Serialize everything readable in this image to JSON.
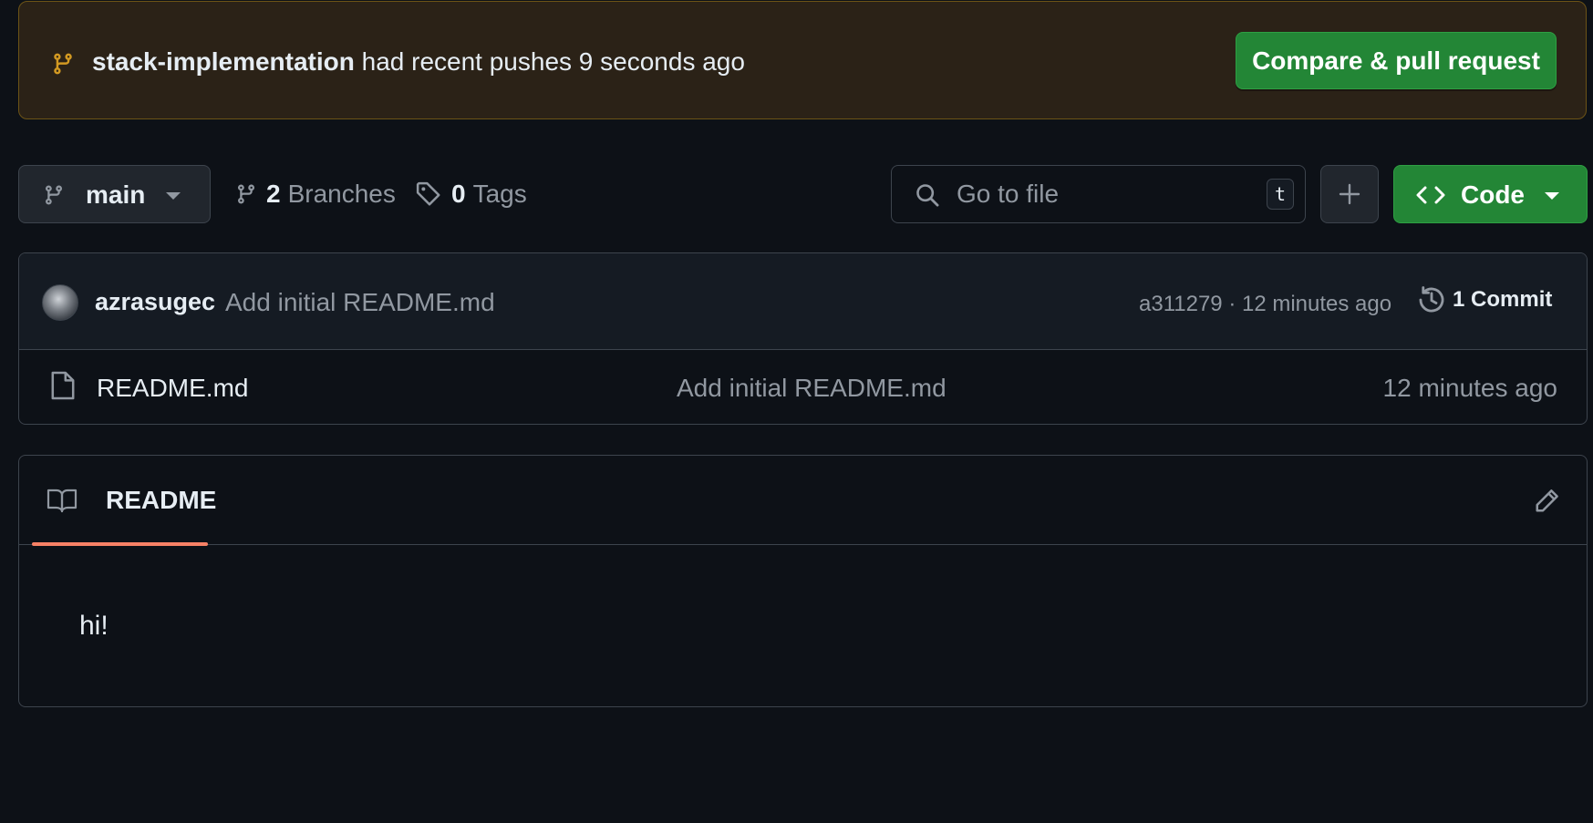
{
  "banner": {
    "branch_name": "stack-implementation",
    "message": " had recent pushes 9 seconds ago",
    "button_label": "Compare & pull request"
  },
  "toolbar": {
    "branch_selector": "main",
    "branches_count": "2",
    "branches_label": "Branches",
    "tags_count": "0",
    "tags_label": "Tags",
    "search_placeholder": "Go to file",
    "search_shortcut": "t",
    "code_label": "Code"
  },
  "latest_commit": {
    "author": "azrasugec",
    "message": "Add initial README.md",
    "meta": "a311279 · 12 minutes ago",
    "commits_label": "1 Commit"
  },
  "files": [
    {
      "name": "README.md",
      "message": "Add initial README.md",
      "time": "12 minutes ago"
    }
  ],
  "readme": {
    "tab_label": "README",
    "content": "hi!"
  },
  "icons": {
    "banner": "git-branch-icon",
    "branch": "git-branch-icon",
    "branches": "git-branch-icon",
    "tags": "tag-icon",
    "search": "search-icon",
    "add": "plus-icon",
    "code": "code-icon",
    "history": "history-icon",
    "file": "file-icon",
    "book": "book-icon",
    "edit": "pencil-icon"
  },
  "colors": {
    "background": "#0d1117",
    "banner_bg": "#2b2217",
    "banner_border": "#6c5316",
    "banner_icon": "#d29922",
    "primary_button": "#238636",
    "tab_underline": "#f78166",
    "muted_text": "#9198a1"
  }
}
